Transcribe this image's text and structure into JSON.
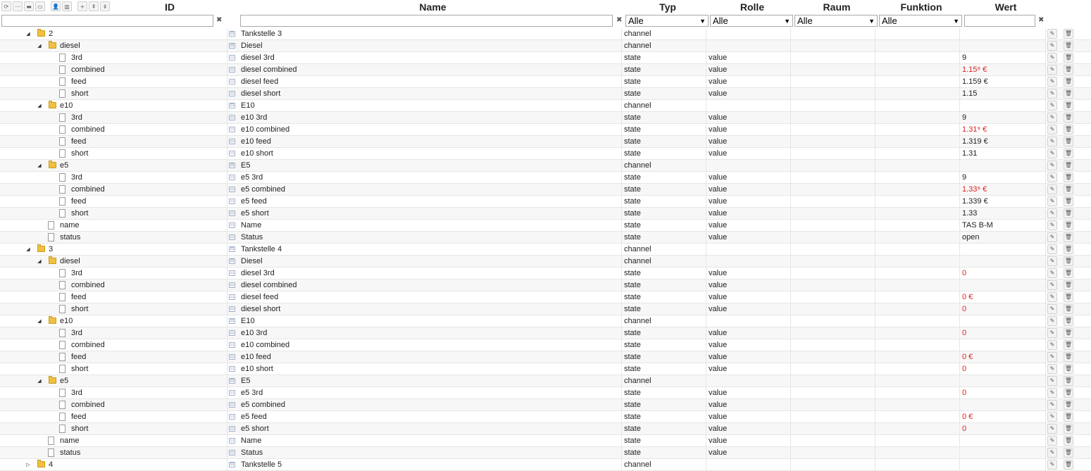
{
  "toolbar": [
    {
      "name": "refresh-icon",
      "glyph": "⟳"
    },
    {
      "name": "dots-icon",
      "glyph": "⋯"
    },
    {
      "name": "folder-closed-icon",
      "glyph": "▬"
    },
    {
      "name": "folder-open-icon",
      "glyph": "▭"
    },
    {
      "name": "user-icon",
      "glyph": "👤"
    },
    {
      "name": "columns-icon",
      "glyph": "▥"
    },
    {
      "name": "add-icon",
      "glyph": "+"
    },
    {
      "name": "import-icon",
      "glyph": "⇞"
    },
    {
      "name": "export-icon",
      "glyph": "⇟"
    }
  ],
  "columns": {
    "id": "ID",
    "name": "Name",
    "typ": "Typ",
    "rolle": "Rolle",
    "raum": "Raum",
    "funktion": "Funktion",
    "wert": "Wert"
  },
  "filters": {
    "id_value": "",
    "name_value": "",
    "typ_selected": "Alle",
    "rolle_selected": "Alle",
    "raum_selected": "Alle",
    "funktion_selected": "Alle",
    "wert_value": "",
    "clear_glyph": "✖"
  },
  "icons": {
    "expanded": "◢",
    "collapsed": "▷",
    "edit": "✎",
    "delete": "🗑",
    "channel": "⊡",
    "state": "▭"
  },
  "colors": {
    "error_value": "#e02020",
    "folder": "#f0c040"
  },
  "rows": [
    {
      "level": 0,
      "kind": "folder",
      "open": true,
      "id": "2",
      "name": "Tankstelle 3",
      "typ": "channel",
      "rolle": "",
      "wert": "",
      "red": false
    },
    {
      "level": 1,
      "kind": "folder",
      "open": true,
      "id": "diesel",
      "name": "Diesel",
      "typ": "channel",
      "rolle": "",
      "wert": "",
      "red": false
    },
    {
      "level": 2,
      "kind": "file",
      "id": "3rd",
      "name": "diesel 3rd",
      "typ": "state",
      "rolle": "value",
      "wert": "9",
      "red": false
    },
    {
      "level": 2,
      "kind": "file",
      "id": "combined",
      "name": "diesel combined",
      "typ": "state",
      "rolle": "value",
      "wert": "1.15⁹ €",
      "red": true
    },
    {
      "level": 2,
      "kind": "file",
      "id": "feed",
      "name": "diesel feed",
      "typ": "state",
      "rolle": "value",
      "wert": "1.159 €",
      "red": false
    },
    {
      "level": 2,
      "kind": "file",
      "id": "short",
      "name": "diesel short",
      "typ": "state",
      "rolle": "value",
      "wert": "1.15",
      "red": false
    },
    {
      "level": 1,
      "kind": "folder",
      "open": true,
      "id": "e10",
      "name": "E10",
      "typ": "channel",
      "rolle": "",
      "wert": "",
      "red": false
    },
    {
      "level": 2,
      "kind": "file",
      "id": "3rd",
      "name": "e10 3rd",
      "typ": "state",
      "rolle": "value",
      "wert": "9",
      "red": false
    },
    {
      "level": 2,
      "kind": "file",
      "id": "combined",
      "name": "e10 combined",
      "typ": "state",
      "rolle": "value",
      "wert": "1.31⁹ €",
      "red": true
    },
    {
      "level": 2,
      "kind": "file",
      "id": "feed",
      "name": "e10 feed",
      "typ": "state",
      "rolle": "value",
      "wert": "1.319 €",
      "red": false
    },
    {
      "level": 2,
      "kind": "file",
      "id": "short",
      "name": "e10 short",
      "typ": "state",
      "rolle": "value",
      "wert": "1.31",
      "red": false
    },
    {
      "level": 1,
      "kind": "folder",
      "open": true,
      "id": "e5",
      "name": "E5",
      "typ": "channel",
      "rolle": "",
      "wert": "",
      "red": false
    },
    {
      "level": 2,
      "kind": "file",
      "id": "3rd",
      "name": "e5 3rd",
      "typ": "state",
      "rolle": "value",
      "wert": "9",
      "red": false
    },
    {
      "level": 2,
      "kind": "file",
      "id": "combined",
      "name": "e5 combined",
      "typ": "state",
      "rolle": "value",
      "wert": "1.33⁹ €",
      "red": true
    },
    {
      "level": 2,
      "kind": "file",
      "id": "feed",
      "name": "e5 feed",
      "typ": "state",
      "rolle": "value",
      "wert": "1.339 €",
      "red": false
    },
    {
      "level": 2,
      "kind": "file",
      "id": "short",
      "name": "e5 short",
      "typ": "state",
      "rolle": "value",
      "wert": "1.33",
      "red": false
    },
    {
      "level": 1,
      "kind": "file",
      "id": "name",
      "name": "Name",
      "typ": "state",
      "rolle": "value",
      "wert": "TAS B-M",
      "red": false
    },
    {
      "level": 1,
      "kind": "file",
      "id": "status",
      "name": "Status",
      "typ": "state",
      "rolle": "value",
      "wert": "open",
      "red": false
    },
    {
      "level": 0,
      "kind": "folder",
      "open": true,
      "id": "3",
      "name": "Tankstelle 4",
      "typ": "channel",
      "rolle": "",
      "wert": "",
      "red": false
    },
    {
      "level": 1,
      "kind": "folder",
      "open": true,
      "id": "diesel",
      "name": "Diesel",
      "typ": "channel",
      "rolle": "",
      "wert": "",
      "red": false
    },
    {
      "level": 2,
      "kind": "file",
      "id": "3rd",
      "name": "diesel 3rd",
      "typ": "state",
      "rolle": "value",
      "wert": "0",
      "red": true
    },
    {
      "level": 2,
      "kind": "file",
      "id": "combined",
      "name": "diesel combined",
      "typ": "state",
      "rolle": "value",
      "wert": "",
      "red": false
    },
    {
      "level": 2,
      "kind": "file",
      "id": "feed",
      "name": "diesel feed",
      "typ": "state",
      "rolle": "value",
      "wert": "0 €",
      "red": true
    },
    {
      "level": 2,
      "kind": "file",
      "id": "short",
      "name": "diesel short",
      "typ": "state",
      "rolle": "value",
      "wert": "0",
      "red": true
    },
    {
      "level": 1,
      "kind": "folder",
      "open": true,
      "id": "e10",
      "name": "E10",
      "typ": "channel",
      "rolle": "",
      "wert": "",
      "red": false
    },
    {
      "level": 2,
      "kind": "file",
      "id": "3rd",
      "name": "e10 3rd",
      "typ": "state",
      "rolle": "value",
      "wert": "0",
      "red": true
    },
    {
      "level": 2,
      "kind": "file",
      "id": "combined",
      "name": "e10 combined",
      "typ": "state",
      "rolle": "value",
      "wert": "",
      "red": false
    },
    {
      "level": 2,
      "kind": "file",
      "id": "feed",
      "name": "e10 feed",
      "typ": "state",
      "rolle": "value",
      "wert": "0 €",
      "red": true
    },
    {
      "level": 2,
      "kind": "file",
      "id": "short",
      "name": "e10 short",
      "typ": "state",
      "rolle": "value",
      "wert": "0",
      "red": true
    },
    {
      "level": 1,
      "kind": "folder",
      "open": true,
      "id": "e5",
      "name": "E5",
      "typ": "channel",
      "rolle": "",
      "wert": "",
      "red": false
    },
    {
      "level": 2,
      "kind": "file",
      "id": "3rd",
      "name": "e5 3rd",
      "typ": "state",
      "rolle": "value",
      "wert": "0",
      "red": true
    },
    {
      "level": 2,
      "kind": "file",
      "id": "combined",
      "name": "e5 combined",
      "typ": "state",
      "rolle": "value",
      "wert": "",
      "red": false
    },
    {
      "level": 2,
      "kind": "file",
      "id": "feed",
      "name": "e5 feed",
      "typ": "state",
      "rolle": "value",
      "wert": "0 €",
      "red": true
    },
    {
      "level": 2,
      "kind": "file",
      "id": "short",
      "name": "e5 short",
      "typ": "state",
      "rolle": "value",
      "wert": "0",
      "red": true
    },
    {
      "level": 1,
      "kind": "file",
      "id": "name",
      "name": "Name",
      "typ": "state",
      "rolle": "value",
      "wert": "",
      "red": false
    },
    {
      "level": 1,
      "kind": "file",
      "id": "status",
      "name": "Status",
      "typ": "state",
      "rolle": "value",
      "wert": "",
      "red": false
    },
    {
      "level": 0,
      "kind": "folder",
      "open": false,
      "id": "4",
      "name": "Tankstelle 5",
      "typ": "channel",
      "rolle": "",
      "wert": "",
      "red": false
    }
  ]
}
